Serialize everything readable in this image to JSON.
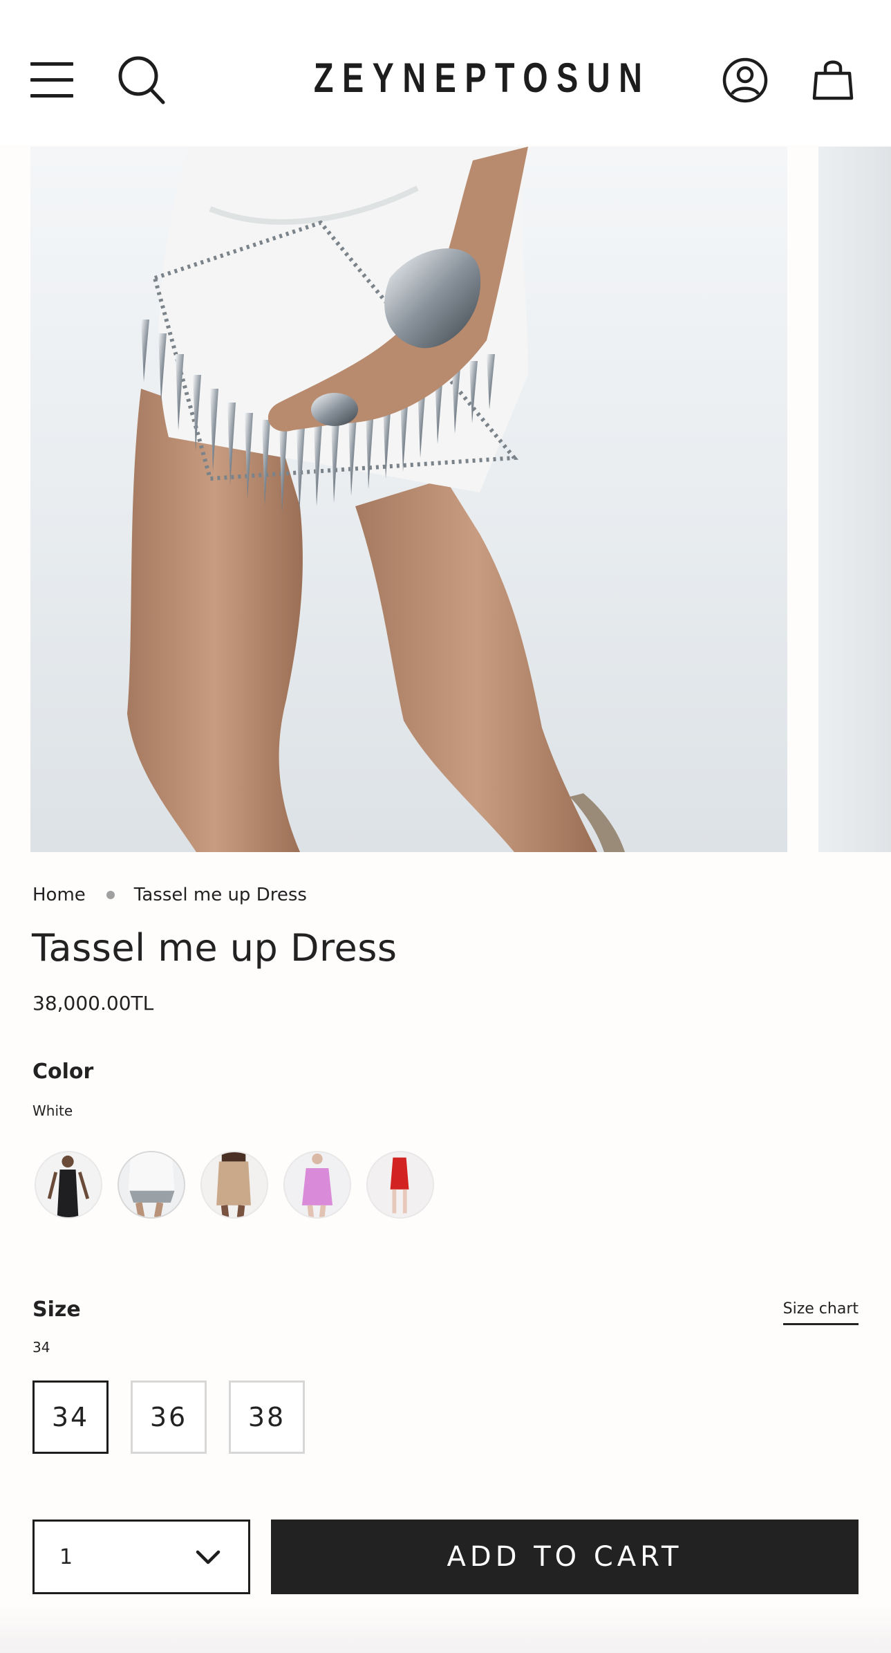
{
  "header": {
    "logo_text": "ZEYNEPTOSUN",
    "icons": [
      "menu-icon",
      "search-icon",
      "account-icon",
      "cart-icon"
    ]
  },
  "breadcrumb": {
    "home": "Home",
    "current": "Tassel me up Dress"
  },
  "product": {
    "title": "Tassel me up Dress",
    "price": "38,000.00TL"
  },
  "color": {
    "label": "Color",
    "selected": "White",
    "swatches": [
      {
        "name": "black-variant",
        "main": "#1f1f22"
      },
      {
        "name": "white-variant",
        "main": "#f1f2f2"
      },
      {
        "name": "beige-variant",
        "main": "#c9a98a"
      },
      {
        "name": "pink-variant",
        "main": "#d98ad8"
      },
      {
        "name": "red-variant",
        "main": "#d32222"
      }
    ]
  },
  "size": {
    "label": "Size",
    "selected": "34",
    "chart_link": "Size chart",
    "options": [
      "34",
      "36",
      "38"
    ]
  },
  "cart": {
    "quantity": "1",
    "add_label": "ADD TO CART"
  },
  "colors": {
    "text": "#222222",
    "button_bg": "#222222",
    "border_inactive": "#d7d7d7"
  }
}
